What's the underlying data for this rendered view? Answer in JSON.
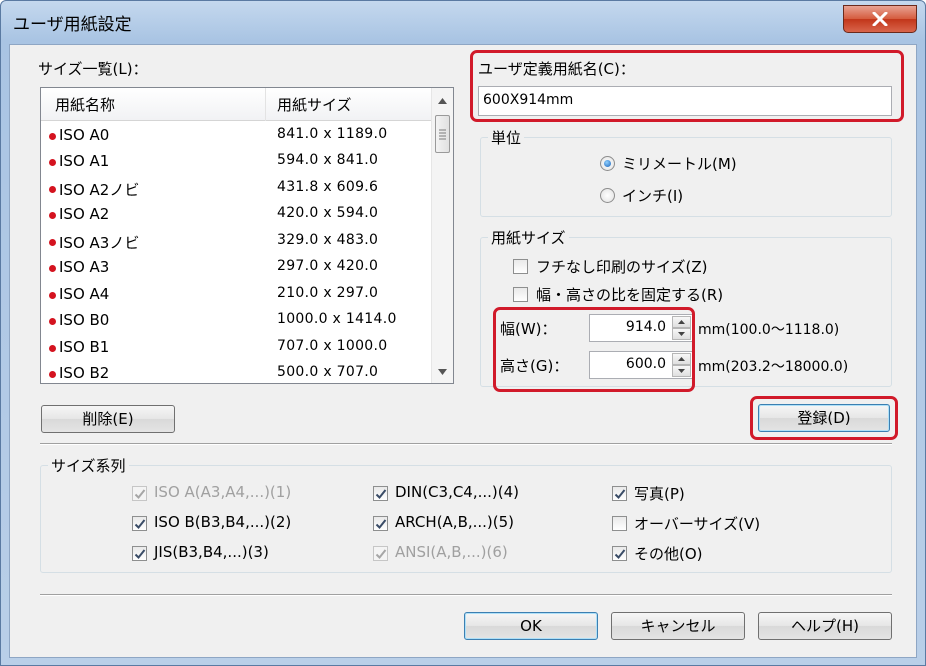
{
  "window": {
    "title": "ユーザ用紙設定"
  },
  "size_list": {
    "label": "サイズ一覧(L)：",
    "columns": [
      "用紙名称",
      "用紙サイズ"
    ],
    "rows": [
      {
        "name": "ISO A0",
        "size": "841.0 x 1189.0"
      },
      {
        "name": "ISO A1",
        "size": "594.0 x 841.0"
      },
      {
        "name": "ISO A2ノビ",
        "size": "431.8 x 609.6"
      },
      {
        "name": "ISO A2",
        "size": "420.0 x 594.0"
      },
      {
        "name": "ISO A3ノビ",
        "size": "329.0 x 483.0"
      },
      {
        "name": "ISO A3",
        "size": "297.0 x 420.0"
      },
      {
        "name": "ISO A4",
        "size": "210.0 x 297.0"
      },
      {
        "name": "ISO B0",
        "size": "1000.0 x 1414.0"
      },
      {
        "name": "ISO B1",
        "size": "707.0 x 1000.0"
      },
      {
        "name": "ISO B2",
        "size": "500.0 x 707.0"
      }
    ],
    "delete_button": "削除(E)"
  },
  "user_paper_name": {
    "label": "ユーザ定義用紙名(C)：",
    "value": "600X914mm"
  },
  "unit": {
    "title": "単位",
    "options": [
      {
        "label": "ミリメートル(M)",
        "selected": true
      },
      {
        "label": "インチ(I)",
        "selected": false
      }
    ]
  },
  "paper_size": {
    "title": "用紙サイズ",
    "borderless_label": "フチなし印刷のサイズ(Z)",
    "borderless_checked": false,
    "fix_ratio_label": "幅・高さの比を固定する(R)",
    "fix_ratio_checked": false,
    "width_label": "幅(W)：",
    "width_value": "914.0",
    "width_range": "mm(100.0〜1118.0)",
    "height_label": "高さ(G)：",
    "height_value": "600.0",
    "height_range": "mm(203.2〜18000.0)"
  },
  "register_button": "登録(D)",
  "size_series": {
    "title": "サイズ系列",
    "items": [
      {
        "label": "ISO A(A3,A4,...)(1)",
        "checked": true,
        "disabled": true
      },
      {
        "label": "ISO B(B3,B4,...)(2)",
        "checked": true,
        "disabled": false
      },
      {
        "label": "JIS(B3,B4,...)(3)",
        "checked": true,
        "disabled": false
      },
      {
        "label": "DIN(C3,C4,...)(4)",
        "checked": true,
        "disabled": false
      },
      {
        "label": "ARCH(A,B,...)(5)",
        "checked": true,
        "disabled": false
      },
      {
        "label": "ANSI(A,B,...)(6)",
        "checked": true,
        "disabled": true
      },
      {
        "label": "写真(P)",
        "checked": true,
        "disabled": false
      },
      {
        "label": "オーバーサイズ(V)",
        "checked": false,
        "disabled": false
      },
      {
        "label": "その他(O)",
        "checked": true,
        "disabled": false
      }
    ]
  },
  "footer": {
    "ok": "OK",
    "cancel": "キャンセル",
    "help": "ヘルプ(H)"
  },
  "colors": {
    "highlight": "#d11a2a",
    "list_bullet": "#d4131f",
    "close_button": "#c2361a"
  }
}
